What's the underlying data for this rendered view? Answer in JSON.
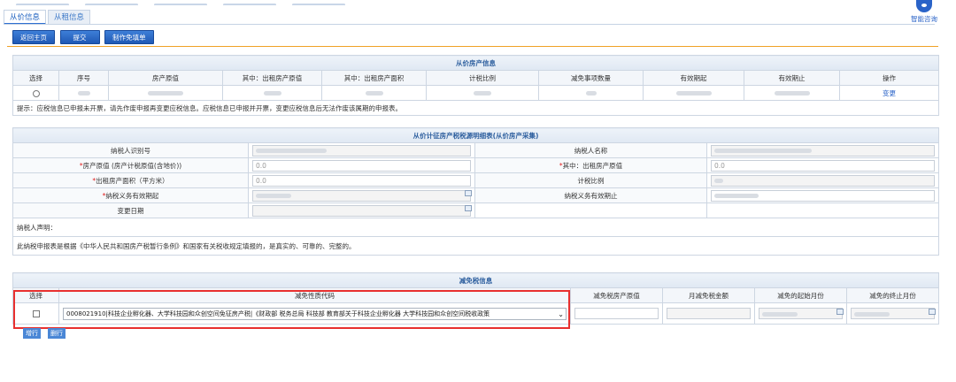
{
  "header": {
    "help_label": "智能咨询",
    "tabs": [
      {
        "label": "从价信息",
        "active": true
      },
      {
        "label": "从租信息",
        "active": false
      }
    ]
  },
  "toolbar": {
    "back_label": "返回主页",
    "submit_label": "提交",
    "exempt_form_label": "制作免填单"
  },
  "price_info": {
    "section_title": "从价房产信息",
    "columns": [
      "选择",
      "序号",
      "房产原值",
      "其中：出租房产原值",
      "其中：出租房产面积",
      "计税比例",
      "减免事项数量",
      "有效期起",
      "有效期止",
      "操作"
    ],
    "row_action": "变更",
    "hint": "提示：应税信息已申报未开票，请先作废申报再变更应税信息。应税信息已申报并开票，变更应税信息后无法作废该属期的申报表。"
  },
  "detail": {
    "section_title": "从价计征房产税税源明细表(从价房产采集)",
    "taxpayer_id_label": "纳税人识别号",
    "taxpayer_name_label": "纳税人名称",
    "original_value_label": "房产原值 (房产计税原值(含地价))",
    "original_value": "0.0",
    "rent_value_label": "其中：出租房产原值",
    "rent_value": "0.0",
    "rent_area_label": "出租房产面积（平方米）",
    "rent_area": "0.0",
    "tax_ratio_label": "计税比例",
    "start_label": "纳税义务有效期起",
    "end_label": "纳税义务有效期止",
    "change_date_label": "变更日期",
    "declaration_label": "纳税人声明：",
    "declaration_text": "此纳税申报表是根据《中华人民共和国房产税暂行条例》和国家有关税收规定填报的，是真实的、可靠的、完整的。"
  },
  "relief": {
    "section_title": "减免税信息",
    "columns": [
      "选择",
      "减免性质代码",
      "减免税房产原值",
      "月减免税金额",
      "减免的起始月份",
      "减免的终止月份"
    ],
    "relief_code": "0008021910|科技企业孵化器、大学科技园和众创空间免征房产税|《财政部 税务总局 科技部 教育部关于科技企业孵化器 大学科技园和众创空间税收政策",
    "add_row_label": "增行",
    "delete_row_label": "删行"
  }
}
